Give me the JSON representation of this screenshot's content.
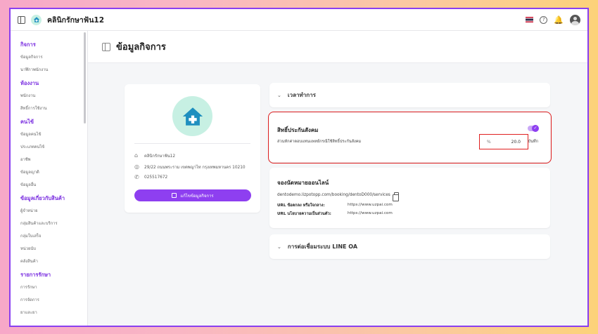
{
  "app": {
    "title": "คลินิกรักษาฟัน12"
  },
  "page": {
    "title": "ข้อมูลกิจการ"
  },
  "sidebar": {
    "groups": [
      {
        "title": "กิจการ",
        "items": [
          "ข้อมูลกิจการ",
          "นาฬิกาพนักงาน"
        ]
      },
      {
        "title": "ห้องงาน",
        "items": [
          "พนักงาน",
          "สิทธิ์การใช้งาน"
        ]
      },
      {
        "title": "คนไข้",
        "items": [
          "ข้อมูลคนไข้",
          "ประเภทคนไข้",
          "อาชีพ",
          "ข้อมูลญาติ",
          "ข้อมูลอื่น"
        ]
      },
      {
        "title": "ข้อมูลเกี่ยวกับสินค้า",
        "items": [
          "ผู้จำหน่าย",
          "กลุ่มสินค้าและบริการ",
          "กลุ่มใบเสร็จ",
          "หน่วยนับ",
          "คลังสินค้า"
        ]
      },
      {
        "title": "รายการรักษา",
        "items": [
          "การรักษา",
          "การจัดการ",
          "ยาและยา"
        ]
      }
    ]
  },
  "profile": {
    "clinic_name": "คลินิกรักษาฟัน12",
    "address": "29/22 ถนนพระราม เขตพญาไท กรุงเทพมหานคร 10210",
    "phone": "025517672",
    "edit_label": "แก้ไขข้อมูลกิจการ"
  },
  "hours": {
    "title": "เวลาทำการ"
  },
  "social": {
    "title": "สิทธิ์ประกันสังคม",
    "description": "ส่วนหักค่าตอบแทนแพทย์กรณีใช้สิทธิ์ประกันสังคม",
    "unit": "%",
    "value": "20.0",
    "save_label": "บันทึก",
    "enabled": true
  },
  "booking": {
    "title": "จองนัดหมายออนไลน์",
    "url": "dentodemo.lizpotopp.com/booking/dentoD000/services",
    "rows": [
      {
        "label": "URL ข้อตกลง หรือใจกลาง:",
        "value": "https://www.uzpai.com"
      },
      {
        "label": "URL นโยบายความเป็นส่วนตัว:",
        "value": "https://www.uzpai.com"
      }
    ]
  },
  "line": {
    "title": "การต่อเชื่อมระบบ LINE OA"
  },
  "colors": {
    "accent": "#8e3ff0",
    "highlight": "#e02020",
    "logo_bg": "#c7f0e3",
    "logo_fg": "#1f8fbf"
  }
}
